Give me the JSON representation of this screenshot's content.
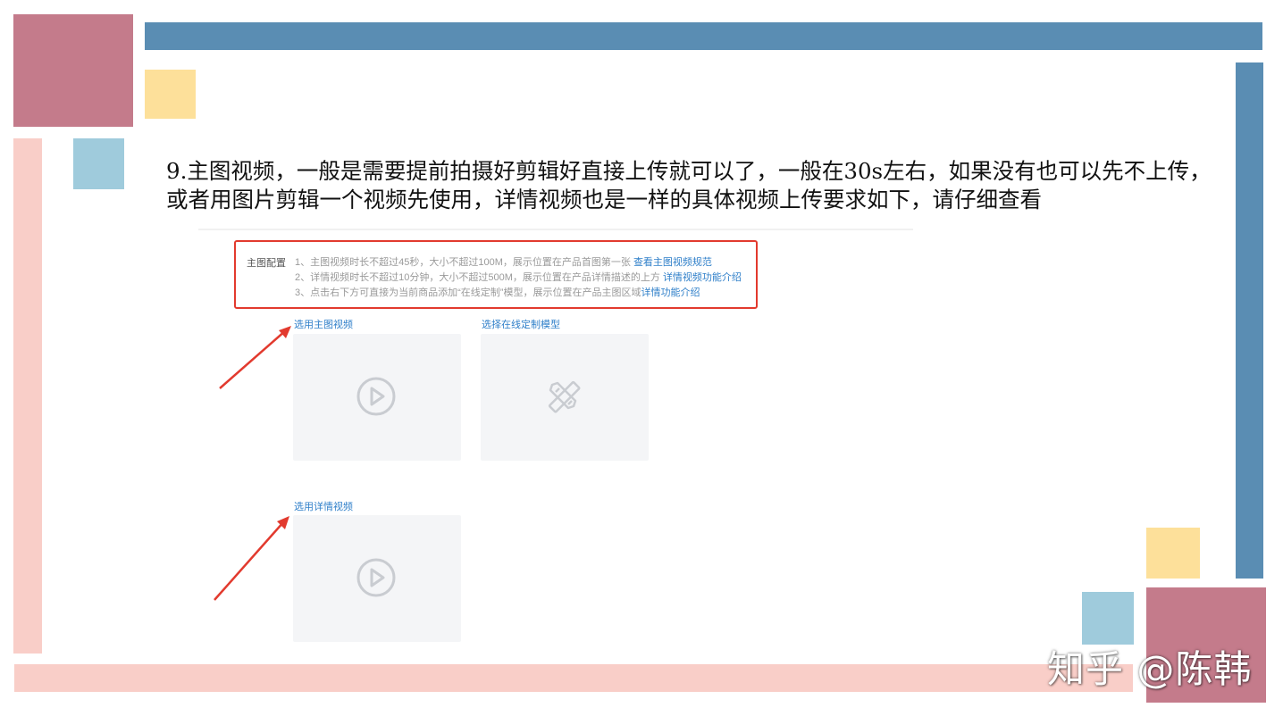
{
  "slide": {
    "text": "9.主图视频，一般是需要提前拍摄好剪辑好直接上传就可以了，一般在30s左右，如果没有也可以先不上传，或者用图片剪辑一个视频先使用，详情视频也是一样的具体视频上传要求如下，请仔细查看"
  },
  "screenshot": {
    "config_label": "主图配置",
    "rules": [
      {
        "text": "1、主图视频时长不超过45秒，大小不超过100M，展示位置在产品首图第一张 ",
        "link": "查看主图视频规范"
      },
      {
        "text": "2、详情视频时长不超过10分钟，大小不超过500M，展示位置在产品详情描述的上方 ",
        "link": "详情视频功能介绍"
      },
      {
        "text": "3、点击右下方可直接为当前商品添加“在线定制”模型，展示位置在产品主图区域",
        "link": "详情功能介绍"
      }
    ],
    "select_main_video": "选用主图视频",
    "select_custom_model": "选择在线定制模型",
    "select_detail_video": "选用详情视频",
    "icons": [
      "play-circle-icon",
      "pencil-ruler-icon",
      "play-circle-icon"
    ]
  },
  "watermark": "知乎 @陈韩",
  "colors": {
    "mauve": "#c47b8b",
    "steel_blue": "#5a8db3",
    "light_yellow": "#fde09a",
    "light_blue": "#9fcbdc",
    "light_pink": "#f9cec8",
    "link_blue": "#2f7fc9",
    "annotation_red": "#e23a2e"
  }
}
